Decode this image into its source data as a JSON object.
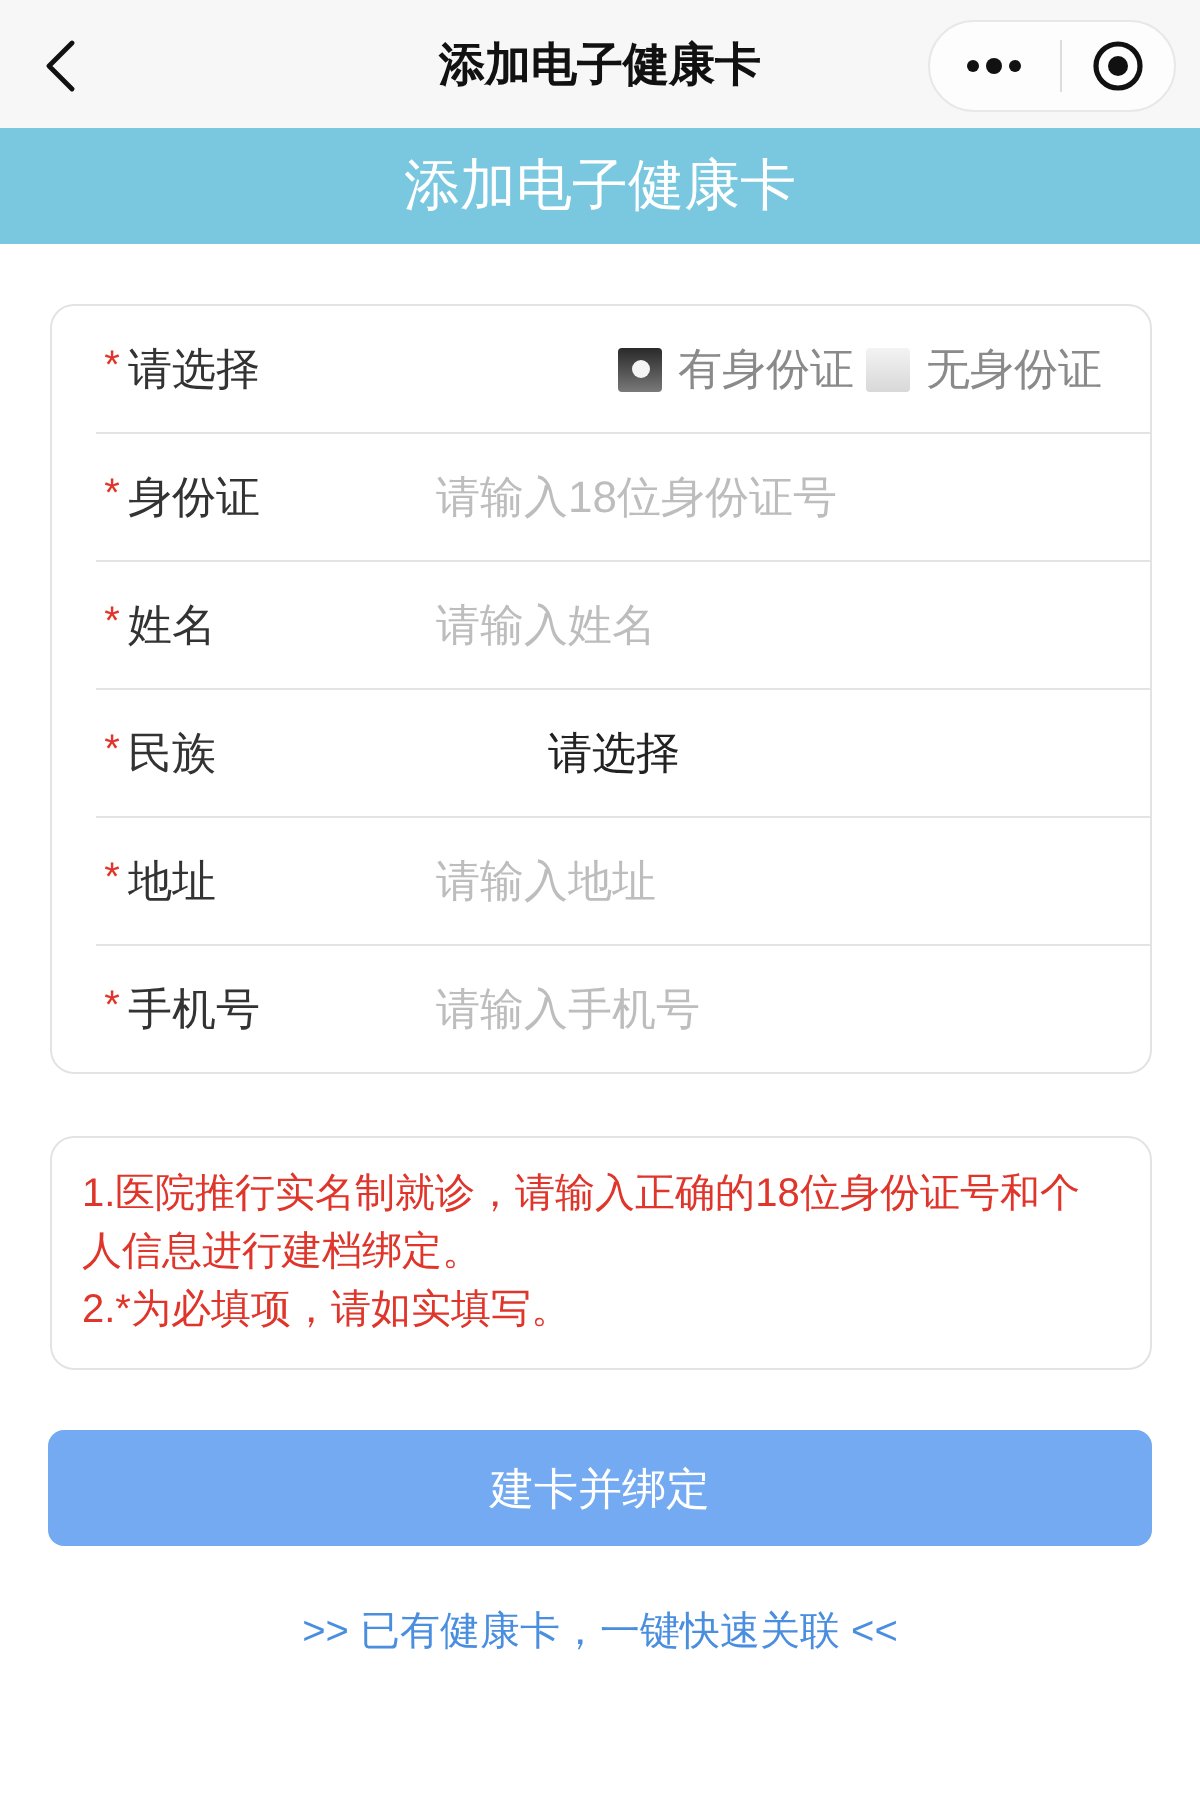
{
  "nav_bar": {
    "title": "添加电子健康卡"
  },
  "banner": {
    "title": "添加电子健康卡"
  },
  "form": {
    "rows": [
      {
        "kind": "radio",
        "mark": "*",
        "label": "请选择",
        "options": [
          {
            "label": "有身份证",
            "selected": true
          },
          {
            "label": "无身份证",
            "selected": false
          }
        ]
      },
      {
        "kind": "input",
        "mark": "*",
        "label": "身份证",
        "placeholder": "请输入18位身份证号"
      },
      {
        "kind": "input",
        "mark": "*",
        "label": "姓名",
        "placeholder": "请输入姓名"
      },
      {
        "kind": "select",
        "mark": "*",
        "label": "民族",
        "value": "请选择"
      },
      {
        "kind": "input",
        "mark": "*",
        "label": "地址",
        "placeholder": "请输入地址"
      },
      {
        "kind": "input",
        "mark": "*",
        "label": "手机号",
        "placeholder": "请输入手机号"
      }
    ]
  },
  "notice": {
    "items": [
      "1.医院推行实名制就诊，请输入正确的18位身份证号和个人信息进行建档绑定。",
      "2.*为必填项，请如实填写。"
    ]
  },
  "submit_button": {
    "label": "建卡并绑定"
  },
  "link": {
    "text": ">> 已有健康卡，一键快速关联 <<"
  }
}
